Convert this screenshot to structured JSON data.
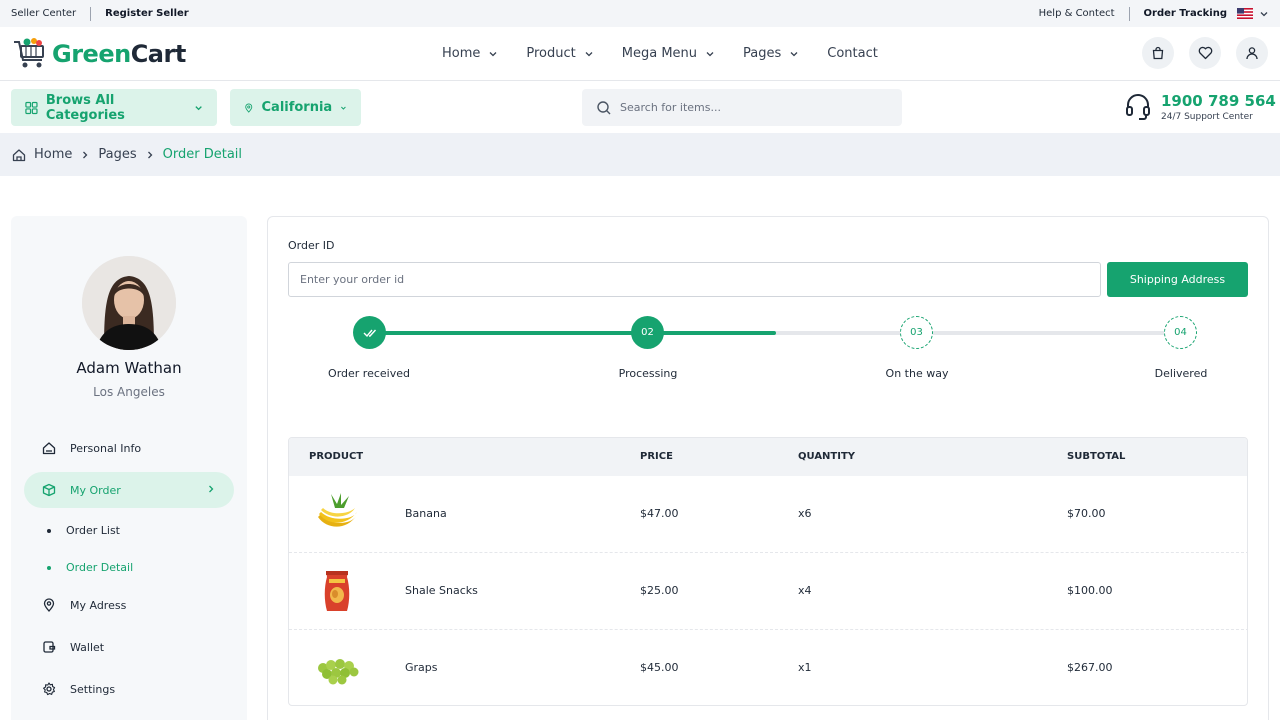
{
  "topbar": {
    "seller_center": "Seller Center",
    "register_seller": "Register Seller",
    "help": "Help & Contect",
    "order_tracking": "Order Tracking"
  },
  "brand": {
    "part1": "Green",
    "part2": "Cart",
    "accent": "#16a36f"
  },
  "nav": [
    {
      "label": "Home",
      "has_dropdown": true
    },
    {
      "label": "Product",
      "has_dropdown": true
    },
    {
      "label": "Mega Menu",
      "has_dropdown": true
    },
    {
      "label": "Pages",
      "has_dropdown": true
    },
    {
      "label": "Contact",
      "has_dropdown": false
    }
  ],
  "header_icons": [
    "shopping-bag-icon",
    "heart-icon",
    "user-icon"
  ],
  "categories_label": "Brows All Categories",
  "location_label": "California",
  "search": {
    "placeholder": "Search for items..."
  },
  "support": {
    "phone": "1900 789 564",
    "caption": "24/7 Support Center"
  },
  "breadcrumb": {
    "home": "Home",
    "pages": "Pages",
    "current": "Order Detail"
  },
  "profile": {
    "name": "Adam Wathan",
    "city": "Los Angeles"
  },
  "sidebar": {
    "personal_info": "Personal Info",
    "my_order": "My Order",
    "order_list": "Order List",
    "order_detail": "Order Detail",
    "my_address": "My Adress",
    "wallet": "Wallet",
    "settings": "Settings"
  },
  "order": {
    "id_label": "Order ID",
    "id_placeholder": "Enter your order id",
    "shipping_button": "Shipping Address"
  },
  "tracking": {
    "progress_fraction": 0.5,
    "steps": [
      {
        "number": "",
        "label": "Order received",
        "done": true
      },
      {
        "number": "02",
        "label": "Processing",
        "done": true
      },
      {
        "number": "03",
        "label": "On the way",
        "done": false
      },
      {
        "number": "04",
        "label": "Delivered",
        "done": false
      }
    ]
  },
  "table": {
    "headers": {
      "product": "PRODUCT",
      "price": "PRICE",
      "quantity": "QUANTITY",
      "subtotal": "SUBTOTAL"
    },
    "rows": [
      {
        "product": "Banana",
        "price": "$47.00",
        "quantity": "x6",
        "subtotal": "$70.00"
      },
      {
        "product": "Shale Snacks",
        "price": "$25.00",
        "quantity": "x4",
        "subtotal": "$100.00"
      },
      {
        "product": "Graps",
        "price": "$45.00",
        "quantity": "x1",
        "subtotal": "$267.00"
      }
    ]
  }
}
